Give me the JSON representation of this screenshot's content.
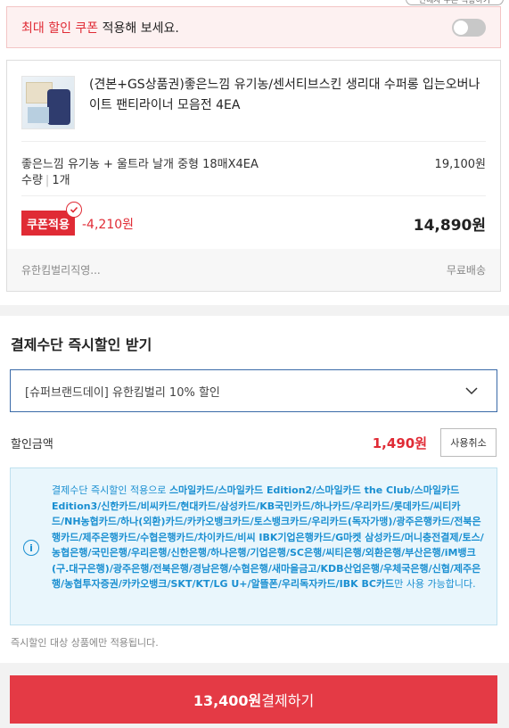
{
  "top_pill": {
    "label": "판매자 쿠폰 적용하기"
  },
  "coupon_banner": {
    "highlight": "최대 할인 쿠폰",
    "rest": " 적용해 보세요.",
    "toggle_on": false
  },
  "product": {
    "title": "(견본+GS상품권)좋은느낌 유기농/센서티브스킨 생리대 수퍼롱 입는오버나이트 팬티라이너 모음전 4EA",
    "option": "좋은느낌 유기농 + 울트라 날개 중형 18매X4EA",
    "option_price": "19,100원",
    "qty_label": "수량",
    "qty_value": "1개",
    "coupon_badge": "쿠폰적용",
    "discount": "-4,210원",
    "final_price": "14,890원",
    "seller": "유한킴벌리직영...",
    "shipping": "무료배송"
  },
  "payment": {
    "title": "결제수단 즉시할인 받기",
    "selected_option": "[슈퍼브랜드데이] 유한킴벌리 10% 할인",
    "discount_label": "할인금액",
    "discount_amount": "1,490원",
    "cancel_label": "사용취소",
    "info_prefix": "결제수단 즉시할인 적용으로 ",
    "info_cards": "스마일카드/스마일카드 Edition2/스마일카드 the Club/스마일카드 Edition3/신한카드/비씨카드/현대카드/삼성카드/KB국민카드/하나카드/우리카드/롯데카드/씨티카드/NH농협카드/하나(외환)카드/카카오뱅크카드/토스뱅크카드/우리카드(독자가맹)/광주은행카드/전북은행카드/제주은행카드/수협은행카드/차이카드/비씨 IBK기업은행카드/G마켓 삼성카드/머니충전결제/토스/농협은행/국민은행/우리은행/신한은행/하나은행/기업은행/SC은행/씨티은행/외환은행/부산은행/iM뱅크(구.대구은행)/광주은행/전북은행/경남은행/수협은행/새마을금고/KDB산업은행/우체국은행/신협/제주은행/농협투자증권/카카오뱅크/SKT/KT/LG U+/알뜰폰/우리독자카드/IBK BC카드",
    "info_suffix": "만 사용 가능합니다.",
    "note": "즉시할인 대상 상품에만 적용됩니다."
  },
  "checkout": {
    "amount": "13,400원",
    "label": " 결제하기"
  },
  "colors": {
    "accent_red": "#e02b35",
    "info_blue": "#1a8fd1",
    "info_bg": "#e9f6fc"
  }
}
